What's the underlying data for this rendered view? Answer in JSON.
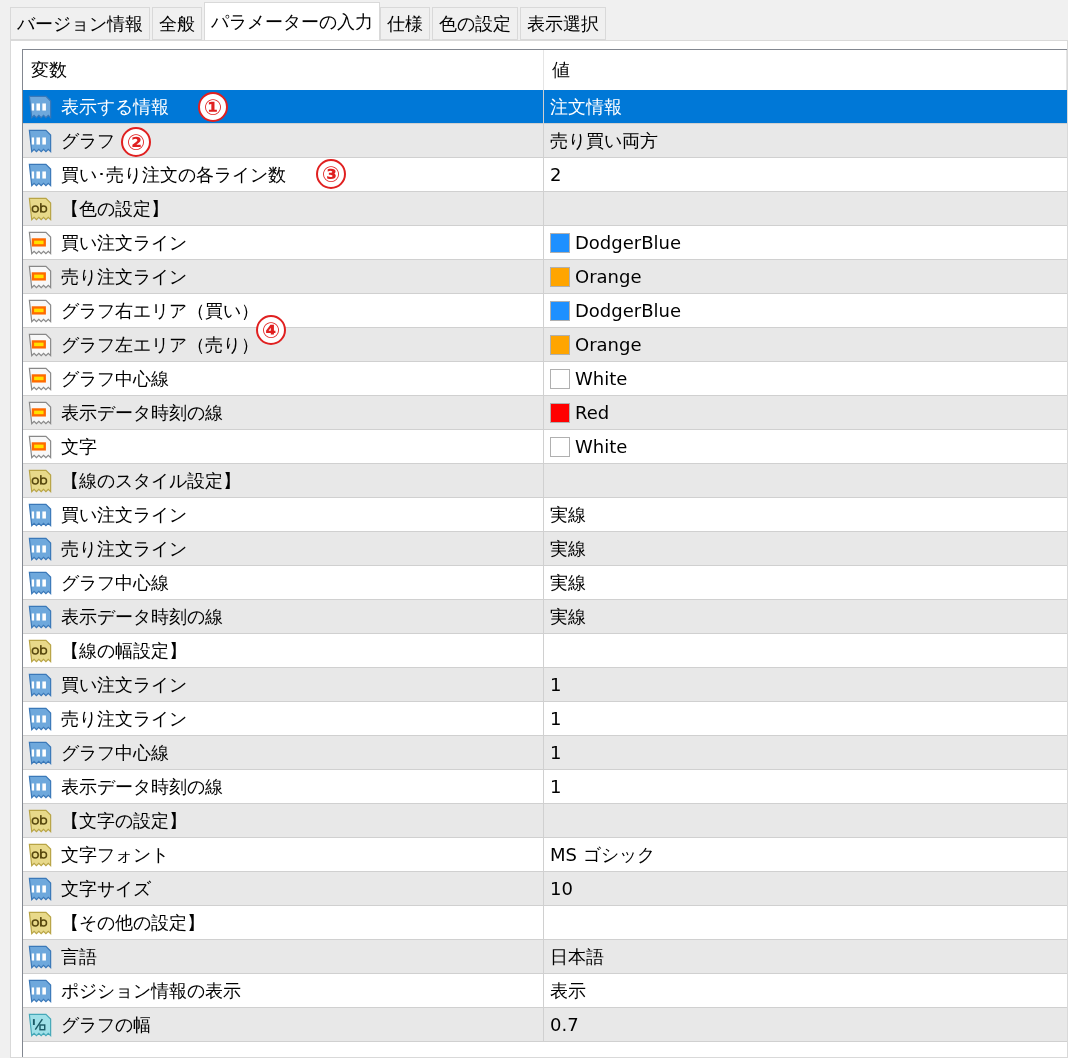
{
  "annotations": [
    "①",
    "②",
    "③",
    "④"
  ],
  "tabs": [
    {
      "label": "バージョン情報",
      "selected": false
    },
    {
      "label": "全般",
      "selected": false
    },
    {
      "label": "パラメーターの入力",
      "selected": true
    },
    {
      "label": "仕様",
      "selected": false
    },
    {
      "label": "色の設定",
      "selected": false
    },
    {
      "label": "表示選択",
      "selected": false
    }
  ],
  "table": {
    "columns": [
      "変数",
      "値"
    ],
    "rows": [
      {
        "kind": "int",
        "name": "表示する情報",
        "value": "注文情報",
        "selected": true
      },
      {
        "kind": "int",
        "name": "グラフ",
        "value": "売り買い両方",
        "selected": false
      },
      {
        "kind": "int",
        "name": "買い･売り注文の各ライン数",
        "value": "2",
        "selected": false
      },
      {
        "kind": "string",
        "name": "【色の設定】",
        "selected": false
      },
      {
        "kind": "color",
        "name": "買い注文ライン",
        "value": "DodgerBlue",
        "color": "#1e90ff",
        "selected": false
      },
      {
        "kind": "color",
        "name": "売り注文ライン",
        "value": "Orange",
        "color": "#ffa500",
        "selected": false
      },
      {
        "kind": "color",
        "name": "グラフ右エリア（買い）",
        "value": "DodgerBlue",
        "color": "#1e90ff",
        "selected": false
      },
      {
        "kind": "color",
        "name": "グラフ左エリア（売り）",
        "value": "Orange",
        "color": "#ffa500",
        "selected": false
      },
      {
        "kind": "color",
        "name": "グラフ中心線",
        "value": "White",
        "color": "#ffffff",
        "selected": false
      },
      {
        "kind": "color",
        "name": "表示データ時刻の線",
        "value": "Red",
        "color": "#ff0000",
        "selected": false
      },
      {
        "kind": "color",
        "name": "文字",
        "value": "White",
        "color": "#ffffff",
        "selected": false
      },
      {
        "kind": "string",
        "name": "【線のスタイル設定】",
        "selected": false
      },
      {
        "kind": "int",
        "name": "買い注文ライン",
        "value": "実線",
        "selected": false
      },
      {
        "kind": "int",
        "name": "売り注文ライン",
        "value": "実線",
        "selected": false
      },
      {
        "kind": "int",
        "name": "グラフ中心線",
        "value": "実線",
        "selected": false
      },
      {
        "kind": "int",
        "name": "表示データ時刻の線",
        "value": "実線",
        "selected": false
      },
      {
        "kind": "string",
        "name": "【線の幅設定】",
        "selected": false
      },
      {
        "kind": "int",
        "name": "買い注文ライン",
        "value": "1",
        "selected": false
      },
      {
        "kind": "int",
        "name": "売り注文ライン",
        "value": "1",
        "selected": false
      },
      {
        "kind": "int",
        "name": "グラフ中心線",
        "value": "1",
        "selected": false
      },
      {
        "kind": "int",
        "name": "表示データ時刻の線",
        "value": "1",
        "selected": false
      },
      {
        "kind": "string",
        "name": "【文字の設定】",
        "selected": false
      },
      {
        "kind": "string",
        "name": "文字フォント",
        "value": "MS ゴシック",
        "selected": false
      },
      {
        "kind": "int",
        "name": "文字サイズ",
        "value": "10",
        "selected": false
      },
      {
        "kind": "string",
        "name": "【その他の設定】",
        "selected": false
      },
      {
        "kind": "int",
        "name": "言語",
        "value": "日本語",
        "selected": false
      },
      {
        "kind": "int",
        "name": "ポジション情報の表示",
        "value": "表示",
        "selected": false
      },
      {
        "kind": "double",
        "name": "グラフの幅",
        "value": "0.7",
        "selected": false
      }
    ]
  }
}
